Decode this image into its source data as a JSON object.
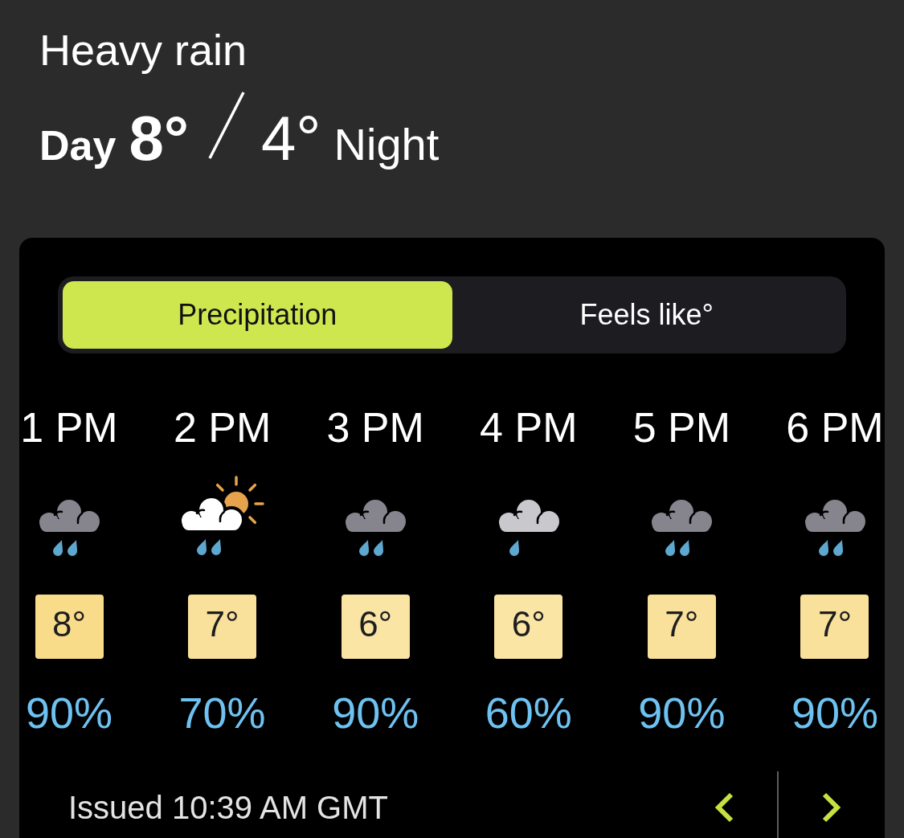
{
  "summary": {
    "condition": "Heavy rain",
    "day_label": "Day",
    "day_temp": "8°",
    "night_temp": "4°",
    "night_label": "Night"
  },
  "forecast": {
    "tabs": [
      {
        "label": "Precipitation",
        "selected": true
      },
      {
        "label": "Feels like°",
        "selected": false
      }
    ],
    "hours": [
      {
        "time": "1 PM",
        "kind": "heavy_rain",
        "temperature": "8°",
        "color": "#f8dc8a",
        "precipitation": "90%"
      },
      {
        "time": "2 PM",
        "kind": "sun_cloud_rain",
        "temperature": "7°",
        "color": "#f9e19b",
        "precipitation": "70%"
      },
      {
        "time": "3 PM",
        "kind": "heavy_rain",
        "temperature": "6°",
        "color": "#fae5a5",
        "precipitation": "90%"
      },
      {
        "time": "4 PM",
        "kind": "light_rain",
        "temperature": "6°",
        "color": "#fae5a5",
        "precipitation": "60%"
      },
      {
        "time": "5 PM",
        "kind": "heavy_rain",
        "temperature": "7°",
        "color": "#f9e19b",
        "precipitation": "90%"
      },
      {
        "time": "6 PM",
        "kind": "heavy_rain",
        "temperature": "7°",
        "color": "#f9e19b",
        "precipitation": "90%"
      }
    ],
    "issued": "Issued 10:39 AM GMT"
  }
}
